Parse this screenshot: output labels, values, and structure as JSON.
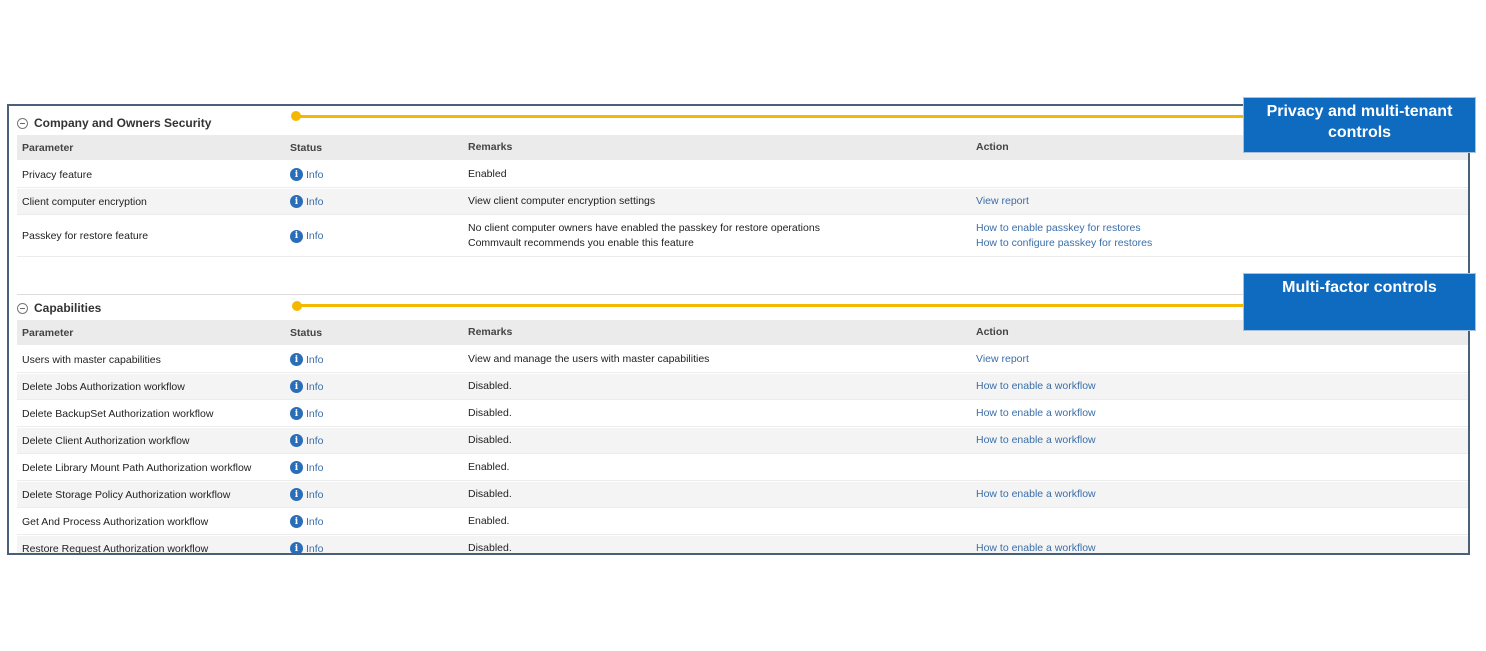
{
  "sections": [
    {
      "title": "Company and Owners Security",
      "headers": [
        "Parameter",
        "Status",
        "Remarks",
        "Action"
      ],
      "rows": [
        {
          "param": "Privacy feature",
          "status": "Info",
          "remarks": [
            "Enabled"
          ],
          "actions": []
        },
        {
          "param": "Client computer encryption",
          "status": "Info",
          "remarks": [
            "View client computer encryption settings"
          ],
          "actions": [
            "View report"
          ]
        },
        {
          "param": "Passkey for restore feature",
          "status": "Info",
          "remarks": [
            "No client computer owners have enabled the passkey for restore operations",
            "Commvault recommends you enable this feature"
          ],
          "actions": [
            "How to enable passkey for restores",
            "How to configure passkey for restores"
          ]
        }
      ]
    },
    {
      "title": "Capabilities",
      "headers": [
        "Parameter",
        "Status",
        "Remarks",
        "Action"
      ],
      "rows": [
        {
          "param": "Users with master capabilities",
          "status": "Info",
          "remarks": [
            "View and manage the users with master capabilities"
          ],
          "actions": [
            "View report"
          ]
        },
        {
          "param": "Delete Jobs Authorization workflow",
          "status": "Info",
          "remarks": [
            "Disabled."
          ],
          "actions": [
            "How to enable a workflow"
          ]
        },
        {
          "param": "Delete BackupSet Authorization workflow",
          "status": "Info",
          "remarks": [
            "Disabled."
          ],
          "actions": [
            "How to enable a workflow"
          ]
        },
        {
          "param": "Delete Client Authorization workflow",
          "status": "Info",
          "remarks": [
            "Disabled."
          ],
          "actions": [
            "How to enable a workflow"
          ]
        },
        {
          "param": "Delete Library Mount Path Authorization workflow",
          "status": "Info",
          "remarks": [
            "Enabled."
          ],
          "actions": []
        },
        {
          "param": "Delete Storage Policy Authorization workflow",
          "status": "Info",
          "remarks": [
            "Disabled."
          ],
          "actions": [
            "How to enable a workflow"
          ]
        },
        {
          "param": "Get And Process Authorization workflow",
          "status": "Info",
          "remarks": [
            "Enabled."
          ],
          "actions": []
        },
        {
          "param": "Restore Request Authorization workflow",
          "status": "Info",
          "remarks": [
            "Disabled."
          ],
          "actions": [
            "How to enable a workflow"
          ]
        }
      ]
    }
  ],
  "callouts": [
    {
      "text": "Privacy and multi-tenant controls"
    },
    {
      "text": "Multi-factor controls"
    }
  ],
  "colors": {
    "accent": "#f5b800",
    "callout": "#0e6bc0",
    "link": "#3a6ea8",
    "border": "#4a5f78"
  }
}
